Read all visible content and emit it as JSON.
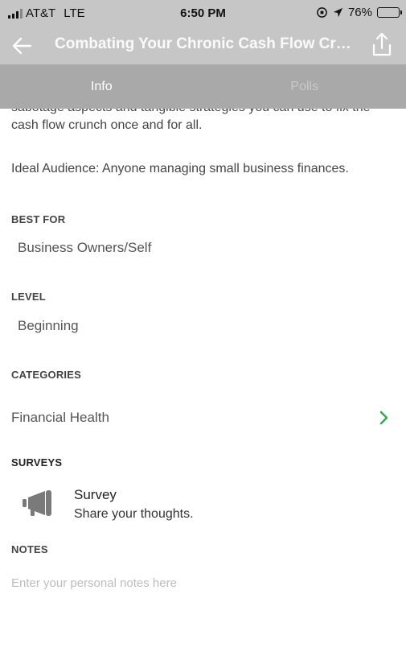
{
  "status": {
    "carrier": "AT&T",
    "network": "LTE",
    "time": "6:50 PM",
    "battery": "76%",
    "battery_level": 0.76
  },
  "nav": {
    "title": "Combating Your Chronic Cash Flow Cri…",
    "back_icon": "arrow-left-icon",
    "share_icon": "share-icon"
  },
  "tabs": [
    {
      "label": "Info",
      "active": true
    },
    {
      "label": "Polls",
      "active": false
    }
  ],
  "description": "sabotage aspects and tangible strategies you can use to fix the cash flow crunch once and for all.",
  "audience": "Ideal Audience: Anyone managing small business finances.",
  "best_for": {
    "label": "BEST FOR",
    "value": "Business Owners/Self"
  },
  "level": {
    "label": "LEVEL",
    "value": "Beginning"
  },
  "categories": {
    "label": "CATEGORIES",
    "items": [
      "Financial Health"
    ]
  },
  "surveys": {
    "label": "SURVEYS",
    "title": "Survey",
    "subtitle": "Share your thoughts."
  },
  "notes": {
    "label": "NOTES",
    "placeholder": "Enter your personal notes here"
  },
  "colors": {
    "nav_bg": "#c6c6c6",
    "tab_bg": "#a9a9a9",
    "chevron": "#3aa65a"
  }
}
